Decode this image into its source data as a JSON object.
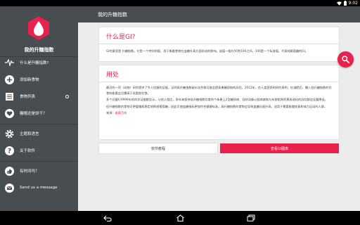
{
  "status_bar": {
    "time": "9:02"
  },
  "drawer": {
    "app_name": "我的升糖指数",
    "items": [
      {
        "label": "什么是升糖指数?",
        "icon": "heartbeat-icon"
      },
      {
        "label": "添加新食物",
        "icon": "add-icon"
      },
      {
        "label": "食物列表",
        "icon": "list-icon"
      },
      {
        "label": "糖帽还是饼干？",
        "icon": "heart-icon"
      },
      {
        "label": "主题和语言",
        "icon": "gear-icon"
      },
      {
        "label": "关于软件",
        "icon": "help-icon"
      },
      {
        "label": "有时间吗？",
        "icon": "thumbs-up-icon"
      },
      {
        "label": "Send us a message",
        "icon": "email-icon"
      }
    ]
  },
  "toolbar": {
    "title": "我的升糖指数"
  },
  "card_gi": {
    "title": "什么是GI?",
    "text": "GI的意思是 升糖指数。它是一个特别的值，用于衡量食物在血糖升高方面形成的影响。该值一般在50到100之间，100是一个标准值，代表纯葡萄糖的GI。"
  },
  "card_use": {
    "title": "用处",
    "p1": "最近的一项（动物）研究提供了令人信服的证据，证明高升糖指数碳水化合物可能会提高患糖尿病的风险。2012年，在人类营养的研究表明，在减肥后，摄入低升糖指数的饮食的能量会比摄高于低脂肪饮食。",
    "p2": "多个近截行9999年的科学证据都显示，与他人相比，多年来保持低升糖指数饮食的个体患上2型糖尿病、冠状动脉心脏病病和与年龄相关的黄斑退化的风险都会显著降低。",
    "p3": "低升糖指数的食物可更缓慢和稳定地释放葡萄糖，因此可使血糖指标更加符合健康标准。高升糖指数的食物会导致血糖迅速升高，适用于需要能量恢复和体力运动的人群。",
    "source_label": "来源：",
    "source_link": "维基百科"
  },
  "buttons": {
    "tutorial": "软件教程",
    "chart": "查看GI图表"
  },
  "colors": {
    "accent": "#e8214d",
    "drawer": "#484d51",
    "background": "#ececec"
  }
}
